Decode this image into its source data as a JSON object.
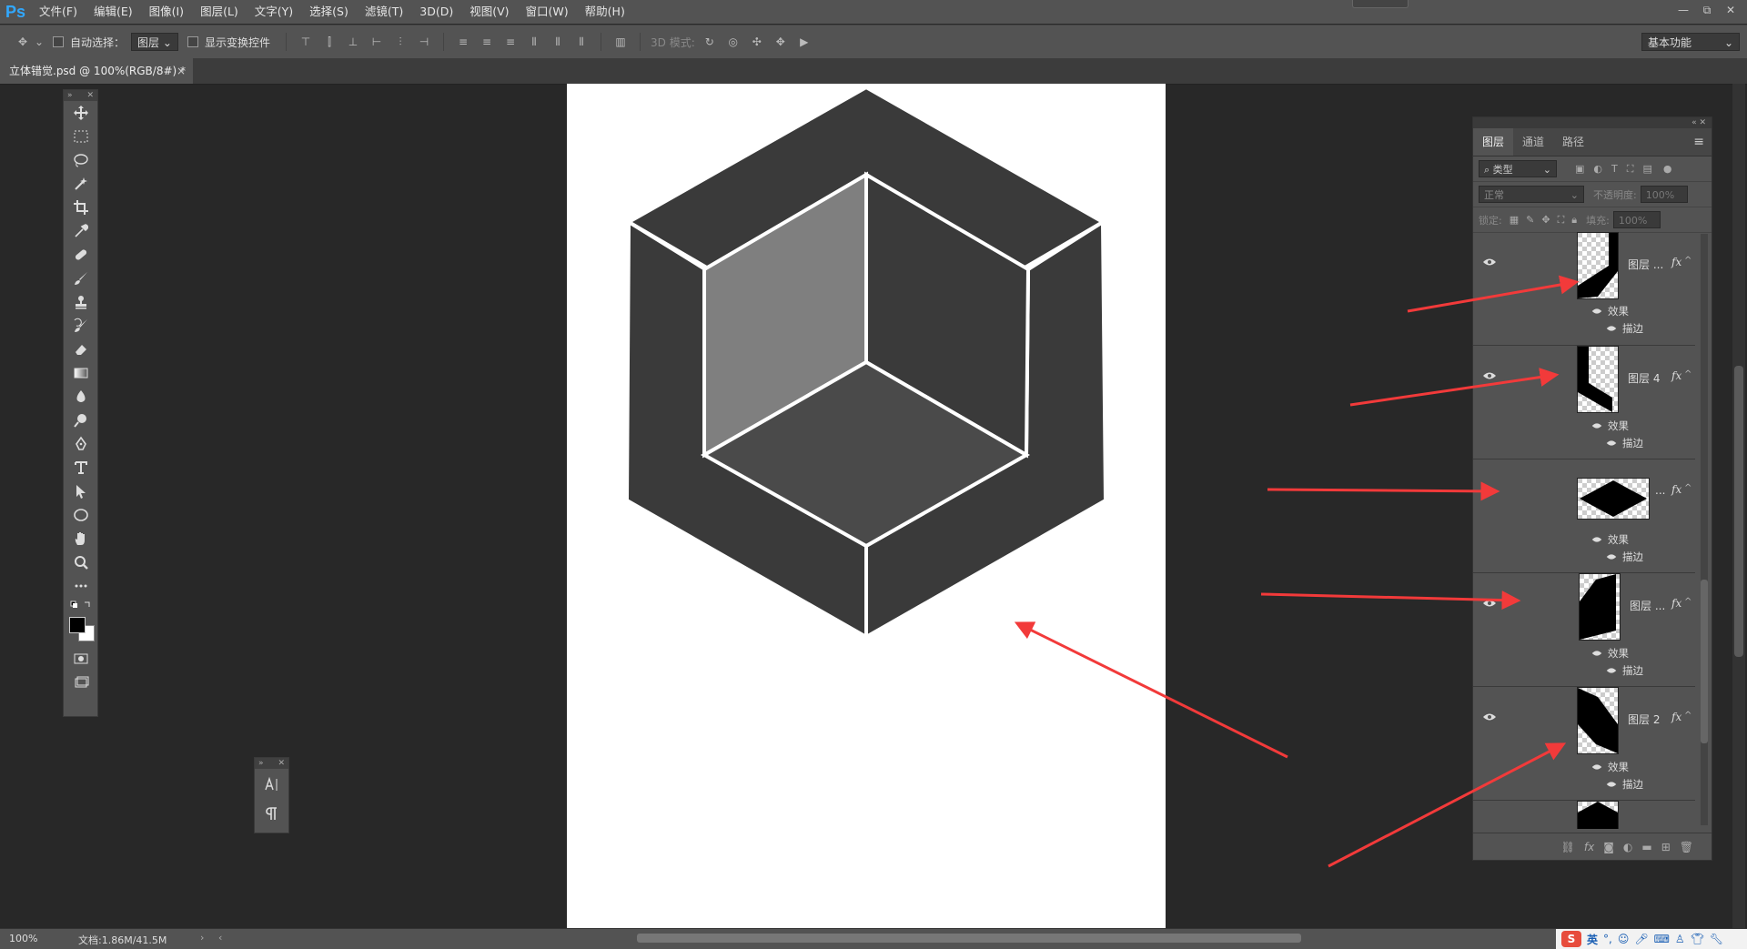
{
  "app": {
    "logo": "Ps"
  },
  "menu": [
    "文件(F)",
    "编辑(E)",
    "图像(I)",
    "图层(L)",
    "文字(Y)",
    "选择(S)",
    "滤镜(T)",
    "3D(D)",
    "视图(V)",
    "窗口(W)",
    "帮助(H)"
  ],
  "window_controls": {
    "minimize": "—",
    "restore": "⧉",
    "close": "✕"
  },
  "options": {
    "auto_select_label": "自动选择：",
    "auto_select_value": "图层",
    "show_transform_label": "显示变换控件",
    "mode_3d_label": "3D 模式:",
    "workspace": "基本功能"
  },
  "document_tab": {
    "title": "立体错觉.psd @ 100%(RGB/8#) *",
    "close": "×"
  },
  "layers_panel": {
    "tabs": [
      "图层",
      "通道",
      "路径"
    ],
    "filter_kind": "类型",
    "blend_mode": "正常",
    "opacity_label": "不透明度:",
    "opacity_value": "100%",
    "lock_label": "锁定:",
    "fill_label": "填充:",
    "fill_value": "100%",
    "effects_label": "效果",
    "stroke_label": "描边",
    "fx": "fx",
    "layers": [
      {
        "name": "图层 ...",
        "eye": true
      },
      {
        "name": "图层 4",
        "eye": true
      },
      {
        "name": "...",
        "eye": false
      },
      {
        "name": "图层 ...",
        "eye": true
      },
      {
        "name": "图层 2",
        "eye": true
      }
    ]
  },
  "status": {
    "zoom": "100%",
    "doc_size": "文档:1.86M/41.5M"
  },
  "tray": {
    "ime": "英"
  },
  "colors": {
    "cube_dark": "#3a3a3a",
    "cube_left_wall": "#7f7f7f",
    "cube_floor": "#4a4a4a",
    "arrow": "#f23a3a"
  }
}
